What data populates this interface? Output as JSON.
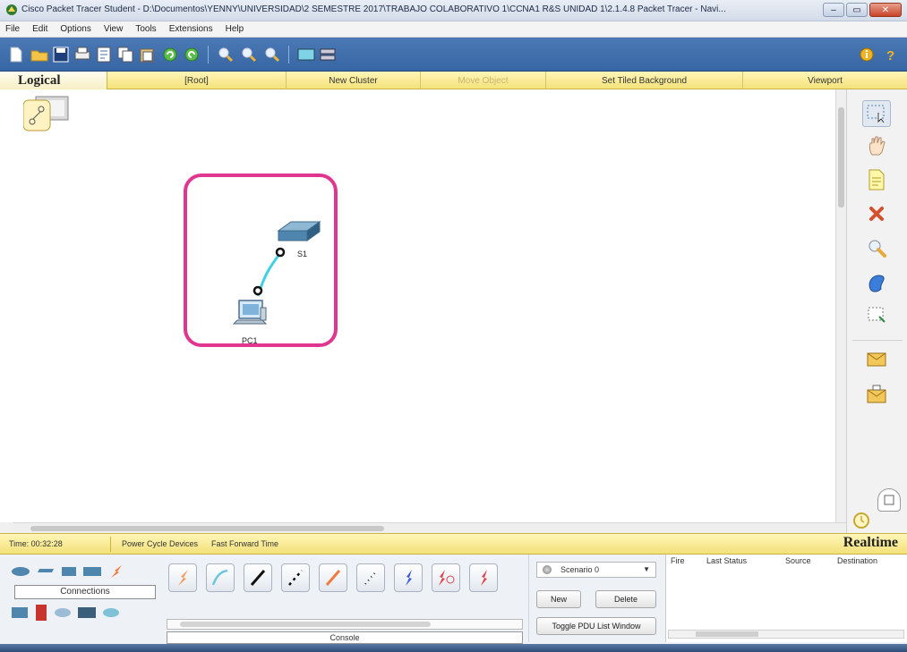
{
  "window": {
    "title": "Cisco Packet Tracer Student - D:\\Documentos\\YENNY\\UNIVERSIDAD\\2 SEMESTRE 2017\\TRABAJO COLABORATIVO 1\\CCNA1 R&S UNIDAD 1\\2.1.4.8 Packet Tracer - Navi...",
    "minimize": "–",
    "maximize": "▭",
    "close": "✕"
  },
  "menu": [
    "File",
    "Edit",
    "Options",
    "View",
    "Tools",
    "Extensions",
    "Help"
  ],
  "workspace_bar": {
    "logical": "Logical",
    "root": "[Root]",
    "new_cluster": "New Cluster",
    "move_object": "Move Object",
    "set_tiled_background": "Set Tiled Background",
    "viewport": "Viewport"
  },
  "topology": {
    "switch_label": "S1",
    "pc_label": "PC1"
  },
  "status_bar": {
    "time": "Time: 00:32:28",
    "power_cycle": "Power Cycle Devices",
    "fast_forward": "Fast Forward Time",
    "mode": "Realtime"
  },
  "device_panel": {
    "category_label": "Connections",
    "console_label": "Console"
  },
  "scenario": {
    "selected": "Scenario 0",
    "new_button": "New",
    "delete_button": "Delete",
    "toggle_button": "Toggle PDU List Window"
  },
  "pdu_list": {
    "columns": [
      "Fire",
      "Last Status",
      "Source",
      "Destination"
    ]
  },
  "colors": {
    "toolbar_blue": "#4275b3",
    "workspace_yellow": "#f4e37b",
    "highlight_pink": "#e0368f",
    "cable_cyan": "#3fd0e6"
  }
}
